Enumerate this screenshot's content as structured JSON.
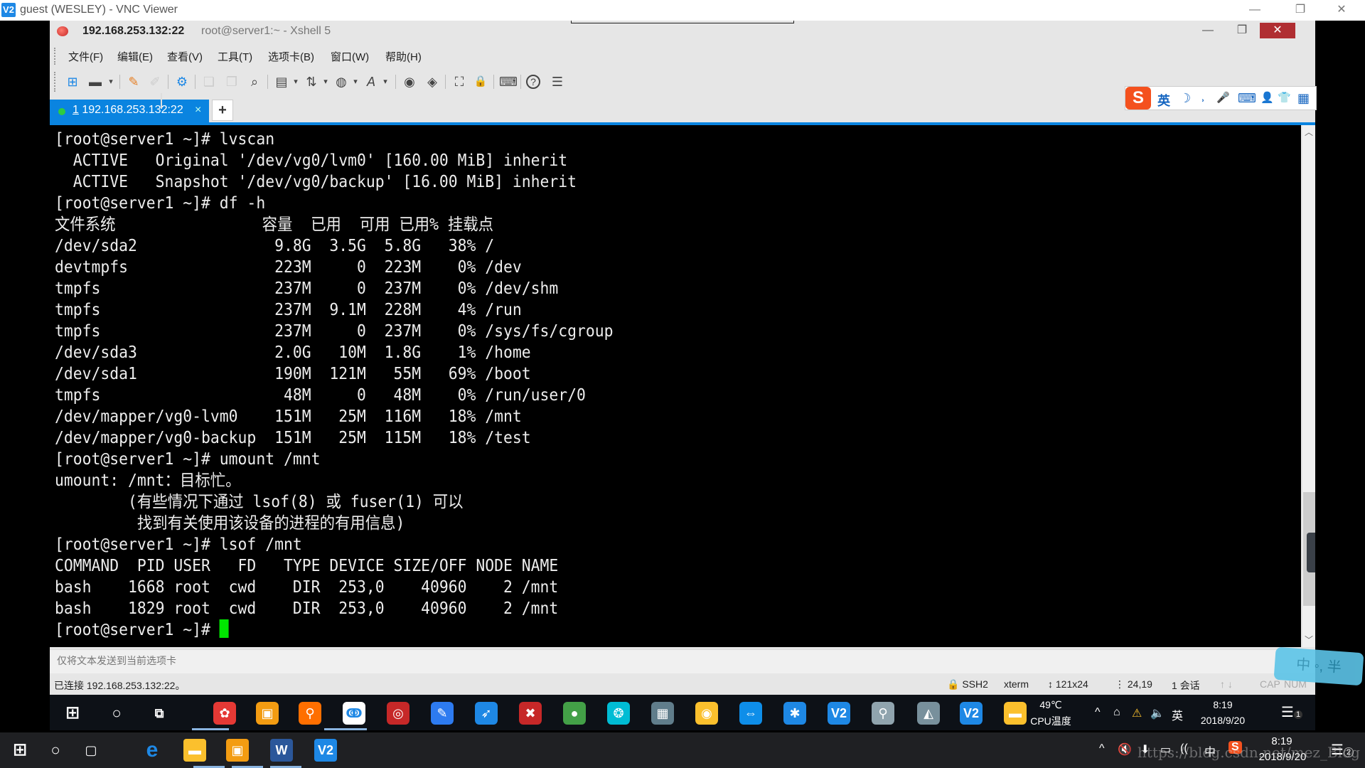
{
  "vnc": {
    "title": "guest (WESLEY) - VNC Viewer",
    "logo": "V2",
    "minimize": "—",
    "restore": "❐",
    "close": "✕"
  },
  "xshell": {
    "title_host": "192.168.253.132:22",
    "title_sub": "root@server1:~ - Xshell 5",
    "minimize": "—",
    "restore": "❐",
    "close": "✕",
    "menu": [
      {
        "label": "文件(F)"
      },
      {
        "label": "编辑(E)"
      },
      {
        "label": "查看(V)"
      },
      {
        "label": "工具(T)"
      },
      {
        "label": "选项卡(B)"
      },
      {
        "label": "窗口(W)"
      },
      {
        "label": "帮助(H)"
      }
    ],
    "toolbar": {
      "new": "⊞",
      "open": "▬",
      "connect": "✎",
      "disconnect": "✐",
      "properties": "⚙",
      "copy": "❏",
      "paste": "❐",
      "find": "⌕",
      "print": "▤",
      "transfer": "⇅",
      "globe": "◍",
      "font": "A",
      "xftp": "◉",
      "xmanager": "◈",
      "fullscreen": "⛶",
      "lock": "🔒",
      "keyboard": "⌨",
      "help": "?",
      "chat": "☰",
      "dropdown": "▾"
    },
    "tab": {
      "number": "1",
      "label": "192.168.253.132:22",
      "close": "×",
      "add": "+"
    },
    "ime_bar": {
      "logo": "S",
      "items": [
        "英",
        "☽",
        "˒",
        "🎤",
        "⌨",
        "👤",
        "👕",
        "▦"
      ]
    },
    "terminal": {
      "lines": [
        "[root@server1 ~]# lvscan",
        "  ACTIVE   Original '/dev/vg0/lvm0' [160.00 MiB] inherit",
        "  ACTIVE   Snapshot '/dev/vg0/backup' [16.00 MiB] inherit",
        "[root@server1 ~]# df -h",
        "文件系统                容量  已用  可用 已用% 挂载点",
        "/dev/sda2               9.8G  3.5G  5.8G   38% /",
        "devtmpfs                223M     0  223M    0% /dev",
        "tmpfs                   237M     0  237M    0% /dev/shm",
        "tmpfs                   237M  9.1M  228M    4% /run",
        "tmpfs                   237M     0  237M    0% /sys/fs/cgroup",
        "/dev/sda3               2.0G   10M  1.8G    1% /home",
        "/dev/sda1               190M  121M   55M   69% /boot",
        "tmpfs                    48M     0   48M    0% /run/user/0",
        "/dev/mapper/vg0-lvm0    151M   25M  116M   18% /mnt",
        "/dev/mapper/vg0-backup  151M   25M  115M   18% /test",
        "[root@server1 ~]# umount /mnt",
        "umount: /mnt：目标忙。",
        "        (有些情况下通过 lsof(8) 或 fuser(1) 可以",
        "         找到有关使用该设备的进程的有用信息)",
        "[root@server1 ~]# lsof /mnt",
        "COMMAND  PID USER   FD   TYPE DEVICE SIZE/OFF NODE NAME",
        "bash    1668 root  cwd    DIR  253,0    40960    2 /mnt",
        "bash    1829 root  cwd    DIR  253,0    40960    2 /mnt"
      ],
      "prompt": "[root@server1 ~]# ",
      "scroll_up": "︿",
      "scroll_down": "﹀"
    },
    "compose_placeholder": "仅将文本发送到当前选项卡",
    "status": {
      "connected": "已连接 192.168.253.132:22。",
      "protocol": "🔒 SSH2",
      "term": "xterm",
      "size": "↕ 121x24",
      "cursor_pos": "⋮ 24,19",
      "sessions": "1 会话",
      "arrows": "↑ ↓",
      "caps": "CAP",
      "num": "NUM"
    }
  },
  "ime_float": "中 ◦, 半",
  "remote_taskbar": {
    "start": "⊞",
    "search": "○",
    "taskview": "⧉",
    "apps": [
      {
        "name": "pinwheel",
        "glyph": "✿",
        "color": "#e53935"
      },
      {
        "name": "vmware",
        "glyph": "▣",
        "color": "#f39c12"
      },
      {
        "name": "search-tool",
        "glyph": "⚲",
        "color": "#ff6f00"
      },
      {
        "name": "baidu-netdisk",
        "glyph": "ↂ",
        "color": "#ffffff"
      },
      {
        "name": "xshell",
        "glyph": "◎",
        "color": "#c62828"
      },
      {
        "name": "notes",
        "glyph": "✎",
        "color": "#2d7bf0"
      },
      {
        "name": "xunlei",
        "glyph": "➶",
        "color": "#1e88e5"
      },
      {
        "name": "app-red",
        "glyph": "✖",
        "color": "#c62828"
      },
      {
        "name": "app-green",
        "glyph": "●",
        "color": "#43a047"
      },
      {
        "name": "media",
        "glyph": "❂",
        "color": "#00bcd4"
      },
      {
        "name": "camera",
        "glyph": "▦",
        "color": "#607d8b"
      },
      {
        "name": "chrome",
        "glyph": "◉",
        "color": "#fbc02d"
      },
      {
        "name": "teamviewer",
        "glyph": "⇔",
        "color": "#0e8ee9"
      },
      {
        "name": "app-star",
        "glyph": "✱",
        "color": "#1e88e5"
      },
      {
        "name": "vnc",
        "glyph": "V2",
        "color": "#1e88e5"
      },
      {
        "name": "viewer",
        "glyph": "⚲",
        "color": "#90a4ae"
      },
      {
        "name": "notepad",
        "glyph": "◭",
        "color": "#78909c"
      },
      {
        "name": "vnc-2",
        "glyph": "V2",
        "color": "#1e88e5"
      },
      {
        "name": "explorer",
        "glyph": "▬",
        "color": "#fbc02d"
      }
    ],
    "cpu_temp": "49℃",
    "cpu_label": "CPU温度",
    "tray": [
      "^",
      "⌂",
      "⚠",
      "🔈",
      "英"
    ],
    "time": "8:19",
    "date": "2018/9/20",
    "notifications": "1"
  },
  "local_taskbar": {
    "start": "⊞",
    "search": "○",
    "taskview": "▢",
    "apps": [
      {
        "name": "edge",
        "glyph": "e",
        "color": "#1e88e5"
      },
      {
        "name": "explorer",
        "glyph": "▬",
        "color": "#fbc02d"
      },
      {
        "name": "vmware",
        "glyph": "▣",
        "color": "#f39c12"
      },
      {
        "name": "word",
        "glyph": "W",
        "color": "#2b579a"
      },
      {
        "name": "vnc",
        "glyph": "V2",
        "color": "#1e88e5"
      }
    ],
    "tray": [
      "^",
      "🔇",
      "⬇",
      "▭",
      "((",
      "中",
      "S"
    ],
    "time": "8:19",
    "date": "2018/9/20",
    "notifications": "2"
  },
  "watermark": "https://blog.csdn.net/mez_Blog"
}
